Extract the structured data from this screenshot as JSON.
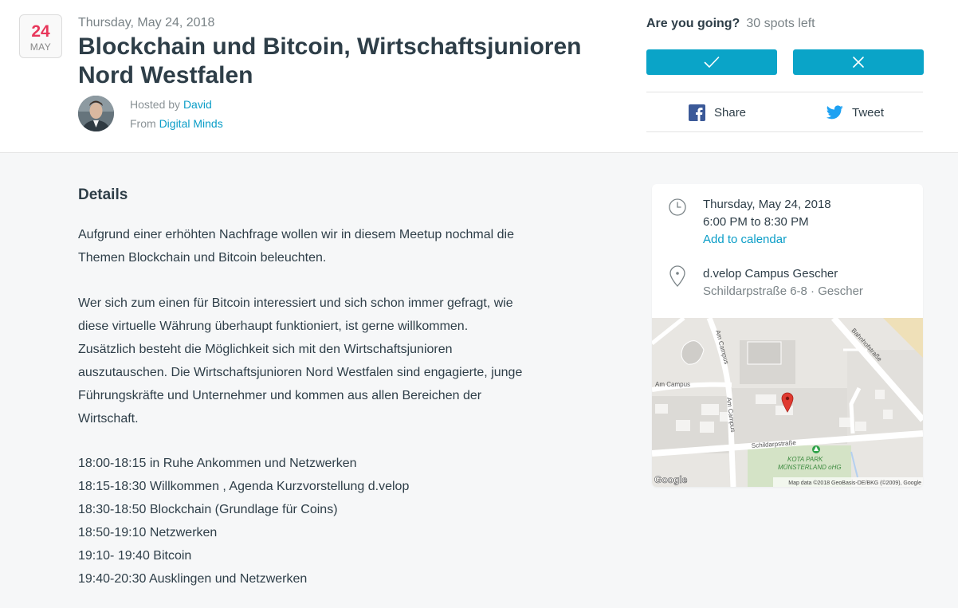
{
  "event": {
    "date_badge": {
      "day": "24",
      "month": "MAY"
    },
    "date_line": "Thursday, May 24, 2018",
    "title": "Blockchain und Bitcoin, Wirtschaftsjunioren Nord Westfalen",
    "hosted_by_label": "Hosted by",
    "host_name": "David",
    "from_label": "From",
    "group_name": "Digital Minds"
  },
  "rsvp": {
    "question": "Are you going?",
    "spots_left": "30 spots left",
    "yes_icon": "check-icon",
    "no_icon": "close-icon",
    "button_color": "#0aa4c8"
  },
  "share": {
    "facebook_label": "Share",
    "twitter_label": "Tweet"
  },
  "details": {
    "heading": "Details",
    "paragraph1_lines": [
      "Aufgrund einer erhöhten Nachfrage wollen wir in diesem Meetup nochmal die",
      "Themen Blockchain und Bitcoin beleuchten."
    ],
    "paragraph2_lines": [
      "Wer sich zum einen für Bitcoin interessiert und sich schon immer gefragt, wie",
      "diese virtuelle Währung überhaupt funktioniert, ist gerne willkommen.",
      "Zusätzlich besteht die Möglichkeit sich mit den Wirtschaftsjunioren",
      "auszutauschen. Die Wirtschaftsjunioren Nord Westfalen sind engagierte, junge",
      "Führungskräfte und Unternehmer und kommen aus allen Bereichen der",
      "Wirtschaft."
    ],
    "agenda": [
      "18:00-18:15 in Ruhe Ankommen und Netzwerken",
      "18:15-18:30 Willkommen , Agenda Kurzvorstellung d.velop",
      "18:30-18:50 Blockchain (Grundlage für Coins)",
      "18:50-19:10 Netzwerken",
      "19:10- 19:40 Bitcoin",
      "19:40-20:30 Ausklingen und Netzwerken"
    ]
  },
  "info_card": {
    "date": "Thursday, May 24, 2018",
    "time": "6:00 PM to 8:30 PM",
    "add_to_calendar": "Add to calendar",
    "venue": "d.velop Campus Gescher",
    "address": "Schildarpstraße 6-8 · Gescher"
  },
  "map": {
    "labels": {
      "am_campus_vertical": "Am Campus",
      "am_campus_horizontal": "Am Campus",
      "am_campus_lower": "Am Campus",
      "bahnhofstrasse": "Bahnhofstraße",
      "schildarpstrasse": "Schildarpstraße",
      "poi_line1": "KOTA PARK",
      "poi_line2": "MÜNSTERLAND oHG"
    },
    "google_logo": "Google",
    "attribution": "Map data ©2018 GeoBasis-DE/BKG (©2009), Google"
  },
  "colors": {
    "accent": "#0aa4c8",
    "link": "#0a9dc7",
    "date_red": "#e8375b",
    "facebook": "#3b5998",
    "twitter": "#1da1f2",
    "map_pin": "#e03a30"
  }
}
